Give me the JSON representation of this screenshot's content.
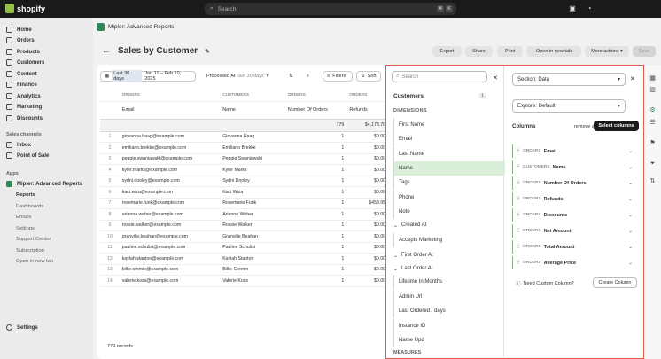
{
  "topbar": {
    "brand": "shopify",
    "search_placeholder": "Search",
    "kbd1": "⌘",
    "kbd2": "K"
  },
  "sidebar": {
    "items": [
      "Home",
      "Orders",
      "Products",
      "Customers",
      "Content",
      "Finance",
      "Analytics",
      "Marketing",
      "Discounts"
    ],
    "sales_channels": "Sales channels",
    "channels": [
      "Inbox",
      "Point of Sale"
    ],
    "apps": "Apps",
    "app": "Mipler: Advanced Reports",
    "subs": [
      "Reports",
      "Dashboards",
      "Emails",
      "Settings",
      "Support Center",
      "Subscription",
      "Open in new tab"
    ],
    "settings": "Settings"
  },
  "header": {
    "app_name": "Mipler: Advanced Reports",
    "title": "Sales by Customer",
    "buttons": {
      "export": "Export",
      "share": "Share",
      "print": "Print",
      "open_tab": "Open in new tab",
      "more": "More actions",
      "save": "Save"
    }
  },
  "filters": {
    "date_preset": "Last 30 days",
    "date_range": "Jan 11 – Feb 10, 2025",
    "processed": "Processed At",
    "processed_val": "last 30 days",
    "filters": "Filters",
    "sort": "Sort"
  },
  "table": {
    "groups": [
      "ORDERS",
      "CUSTOMERS",
      "ORDERS",
      "ORDERS"
    ],
    "columns": [
      "Email",
      "Name",
      "Number Of Orders",
      "Refunds"
    ],
    "totals": [
      "",
      "",
      "779",
      "$4,173.70"
    ],
    "rows": [
      [
        "1",
        "giovanna.haag@example.com",
        "Giovanna Haag",
        "1",
        "$0.00"
      ],
      [
        "2",
        "emiliano.brekke@example.com",
        "Emiliano Brekke",
        "1",
        "$0.00"
      ],
      [
        "3",
        "peggie.swaniawski@example.com",
        "Peggie Swaniawski",
        "1",
        "$0.00"
      ],
      [
        "4",
        "kyler.marks@example.com",
        "Kyler Marks",
        "1",
        "$0.00"
      ],
      [
        "5",
        "sydni.dooley@example.com",
        "Sydni Dooley",
        "1",
        "$0.00"
      ],
      [
        "6",
        "kaci.wiza@example.com",
        "Kaci Wiza",
        "1",
        "$0.00"
      ],
      [
        "7",
        "rosemarie.funk@example.com",
        "Rosemarie Funk",
        "1",
        "$458.95"
      ],
      [
        "8",
        "arianna.weber@example.com",
        "Arianna Weber",
        "1",
        "$0.00"
      ],
      [
        "9",
        "rossie.walker@example.com",
        "Rossie Walker",
        "1",
        "$0.00"
      ],
      [
        "10",
        "granville.beahan@example.com",
        "Granville Beahan",
        "1",
        "$0.00"
      ],
      [
        "11",
        "pauline.schulist@example.com",
        "Pauline Schulist",
        "1",
        "$0.00"
      ],
      [
        "12",
        "kaylah.stanton@example.com",
        "Kaylah Stanton",
        "1",
        "$0.00"
      ],
      [
        "13",
        "billie.cremin@example.com",
        "Billie Cremin",
        "1",
        "$0.00"
      ],
      [
        "14",
        "valerie.koss@example.com",
        "Valerie Koss",
        "1",
        "$0.00"
      ]
    ],
    "footer": "779 records"
  },
  "fields": {
    "search_placeholder": "Search",
    "group": "Customers",
    "count": "1",
    "dimensions": "DIMENSIONS",
    "items": [
      "First Name",
      "Email",
      "Last Name",
      "Name",
      "Tags",
      "Phone",
      "Note"
    ],
    "created_at": "Created At",
    "accepts": "Accepts Marketing",
    "first_order": "First Order At",
    "last_order": "Last Order At",
    "items2": [
      "Lifetime In Months",
      "Admin Url",
      "Last Ordered / days",
      "Instance ID",
      "Name Upd"
    ],
    "measures": "MEASURES"
  },
  "settings": {
    "section": "Section: Data",
    "explore": "Explore: Default",
    "columns": "Columns",
    "remove_all": "remove all",
    "select_columns": "Select columns",
    "cols": [
      [
        "ORDERS",
        "Email"
      ],
      [
        "CUSTOMERS",
        "Name"
      ],
      [
        "ORDERS",
        "Number Of Orders"
      ],
      [
        "ORDERS",
        "Refunds"
      ],
      [
        "ORDERS",
        "Discounts"
      ],
      [
        "ORDERS",
        "Net Amount"
      ],
      [
        "ORDERS",
        "Total Amount"
      ],
      [
        "ORDERS",
        "Average Price"
      ]
    ],
    "need": "Need Custom Column?",
    "create": "Create Column"
  }
}
